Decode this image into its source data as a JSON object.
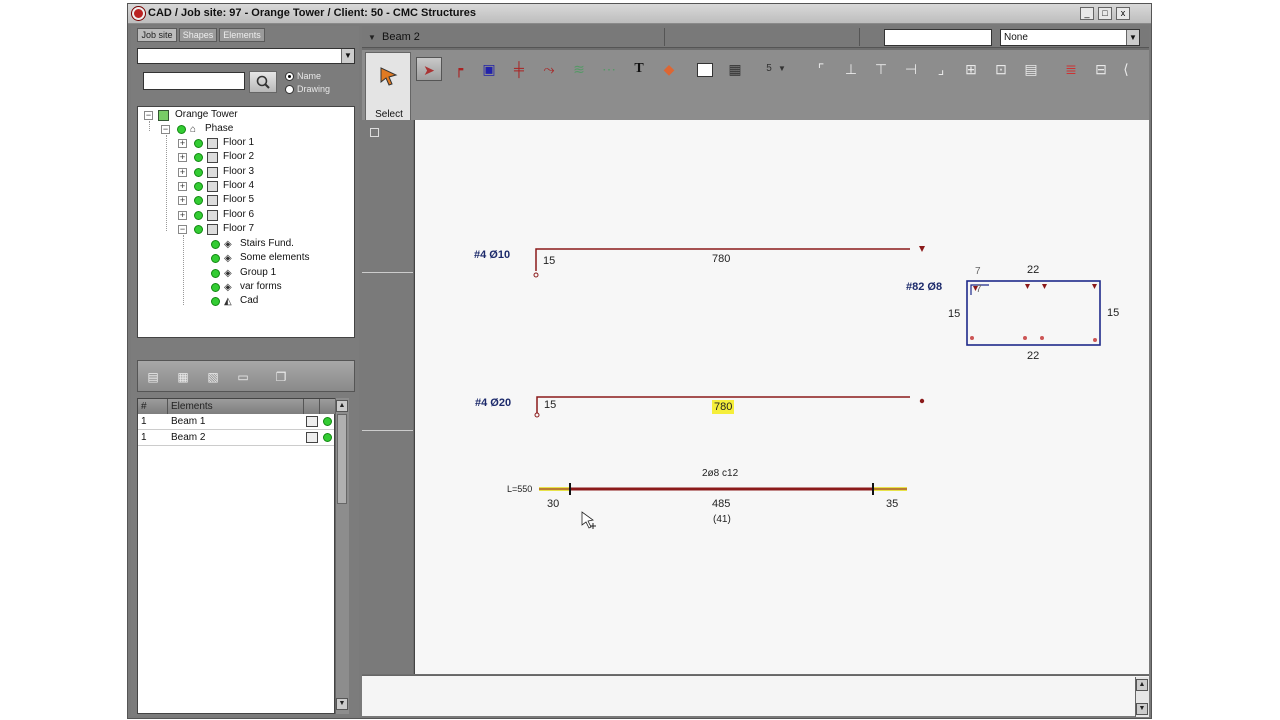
{
  "window": {
    "title": "CAD / Job site: 97 - Orange Tower / Client: 50 - CMC Structures",
    "min_label": "_",
    "max_label": "□",
    "close_label": "x"
  },
  "left_tabs": [
    "Job site",
    "Shapes",
    "Elements"
  ],
  "search": {
    "value": "",
    "radio_name": "Name",
    "radio_drawing": "Drawing"
  },
  "tree": {
    "root": "Orange Tower",
    "phase": "Phase",
    "floors": [
      "Floor 1",
      "Floor 2",
      "Floor 3",
      "Floor 4",
      "Floor 5",
      "Floor 6",
      "Floor 7"
    ],
    "floor7_children": [
      "Stairs  Fund.",
      "Some  elements",
      "Group  1",
      "var forms",
      "Cad"
    ]
  },
  "element_table": {
    "headers": [
      "#",
      "Elements"
    ],
    "rows": [
      {
        "qty": "1",
        "name": "Beam 1"
      },
      {
        "qty": "1",
        "name": "Beam 2"
      }
    ]
  },
  "topbar": {
    "element_name": "Beam 2",
    "search_value": "",
    "filter_value": "None"
  },
  "toolbar": {
    "select_label": "Select",
    "spin_value": "5",
    "text_tool": "T"
  },
  "drawing": {
    "bar1": {
      "label": "#4  Ø10",
      "left": "15",
      "length": "780"
    },
    "bar2": {
      "label": "#4  Ø20",
      "left": "15",
      "length": "780"
    },
    "stirrup": {
      "label": "#82  Ø8",
      "top_hook": "7",
      "hook2": "7",
      "top": "22",
      "left": "15",
      "right": "15",
      "bottom": "22"
    },
    "beam": {
      "length_label": "L=550",
      "spacing": "2ø8  c12",
      "left": "30",
      "middle": "485",
      "count": "(41)",
      "right": "35"
    }
  },
  "colors": {
    "rebar": "#8b1a1a",
    "stirrup": "#1e2a8a",
    "highlight": "#f5ee3a",
    "status_green": "#33cc33"
  }
}
